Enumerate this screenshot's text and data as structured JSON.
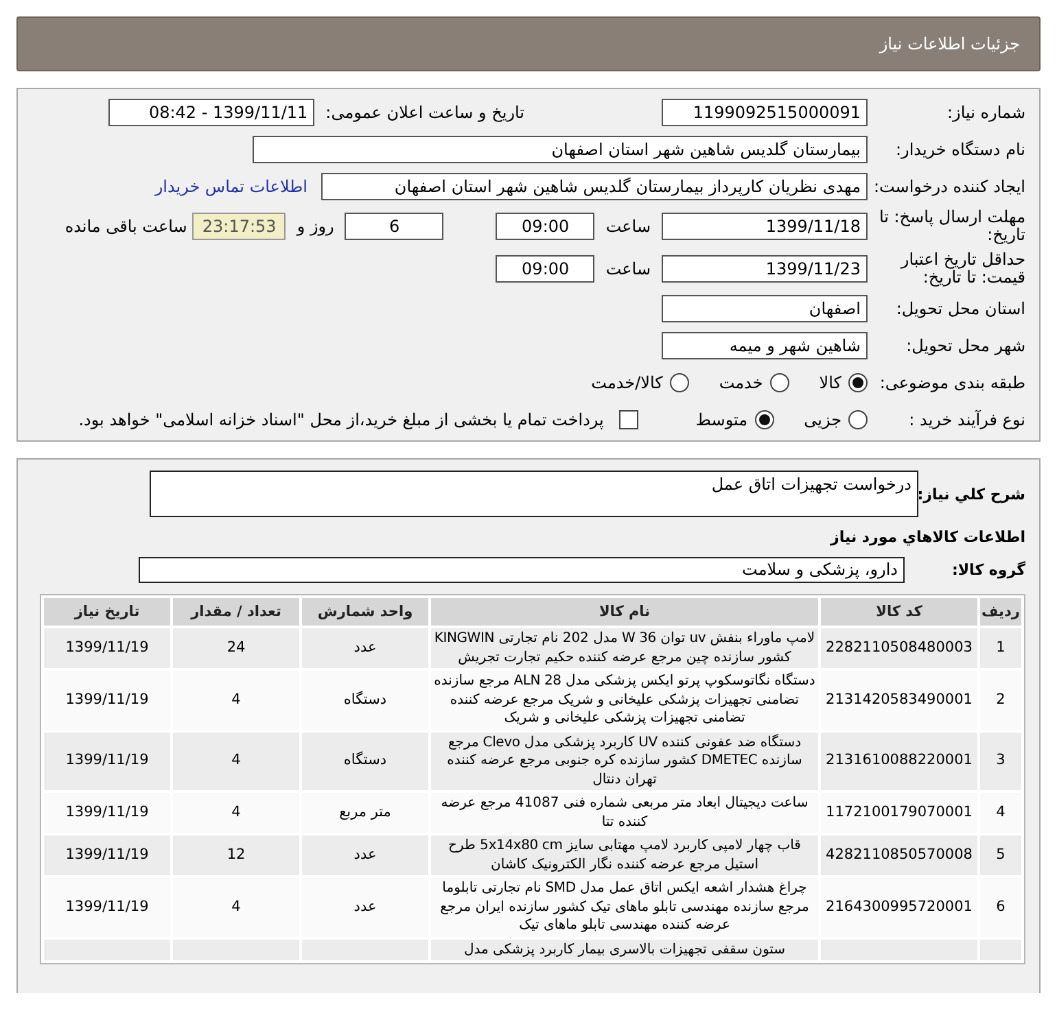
{
  "header": {
    "title": "جزئیات اطلاعات نیاز"
  },
  "need": {
    "need_number": {
      "label": "شماره نیاز:",
      "value": "1199092515000091"
    },
    "announce": {
      "label": "تاریخ و ساعت اعلان عمومی:",
      "value": "1399/11/11 - 08:42"
    },
    "buyer": {
      "label": "نام دستگاه خریدار:",
      "value": "بیمارستان گلدیس شاهین شهر استان اصفهان"
    },
    "creator": {
      "label": "ایجاد کننده درخواست:",
      "value": "مهدی نظریان کارپرداز بیمارستان گلدیس شاهین شهر استان اصفهان",
      "link": "اطلاعات تماس خریدار"
    },
    "deadline": {
      "label": "مهلت ارسال پاسخ: تا تاریخ:",
      "date": "1399/11/18",
      "time_label": "ساعت",
      "time": "09:00",
      "days": "6",
      "days_label": "روز و",
      "remaining": "23:17:53",
      "remaining_label": "ساعت باقی مانده"
    },
    "validity": {
      "label": "حداقل تاریخ اعتبار قیمت: تا تاریخ:",
      "date": "1399/11/23",
      "time_label": "ساعت",
      "time": "09:00"
    },
    "province": {
      "label": "استان محل تحویل:",
      "value": "اصفهان"
    },
    "city": {
      "label": "شهر محل تحویل:",
      "value": "شاهین شهر و میمه"
    },
    "category": {
      "label": "طبقه بندی موضوعی:",
      "options": [
        {
          "label": "کالا",
          "selected": true
        },
        {
          "label": "خدمت",
          "selected": false
        },
        {
          "label": "کالا/خدمت",
          "selected": false
        }
      ]
    },
    "process": {
      "label": "نوع فرآیند خرید :",
      "options": [
        {
          "label": "جزیی",
          "selected": false
        },
        {
          "label": "متوسط",
          "selected": true
        }
      ],
      "treasury": {
        "label": "پرداخت تمام یا بخشی از مبلغ خرید،از محل \"اسناد خزانه اسلامی\" خواهد بود.",
        "checked": false
      }
    }
  },
  "items": {
    "description": {
      "label": "شرح کلي نياز:",
      "value": "درخواست تجهيزات اتاق عمل"
    },
    "heading": "اطلاعات کالاهاي مورد نياز",
    "group": {
      "label": "گروه کالا:",
      "value": "دارو، پزشکی و سلامت"
    },
    "table": {
      "columns": [
        "ردیف",
        "کد کالا",
        "نام کالا",
        "واحد شمارش",
        "تعداد / مقدار",
        "تاریخ نیاز"
      ],
      "rows": [
        [
          "1",
          "2282110508480003",
          "لامپ ماوراء بنفش uv توان W 36 مدل 202 نام تجارتی KINGWIN کشور سازنده چین مرجع عرضه کننده حکیم تجارت تجریش",
          "عدد",
          "24",
          "1399/11/19"
        ],
        [
          "2",
          "2131420583490001",
          "دستگاه نگاتوسکوپ پرتو ایکس پزشکی مدل ALN 28 مرجع سازنده تضامنی تجهیزات پزشکی علیخانی و شریک مرجع عرضه کننده تضامنی تجهیزات پزشکی علیخانی و شریک",
          "دستگاه",
          "4",
          "1399/11/19"
        ],
        [
          "3",
          "2131610088220001",
          "دستگاه ضد عفونی کننده UV کاربرد پزشکی مدل Clevo مرجع سازنده DMETEC کشور سازنده کره جنوبی مرجع عرضه کننده تهران دنتال",
          "دستگاه",
          "4",
          "1399/11/19"
        ],
        [
          "4",
          "1172100179070001",
          "ساعت دیجیتال ابعاد متر مربعی شماره فنی 41087 مرجع عرضه کننده تتا",
          "متر مربع",
          "4",
          "1399/11/19"
        ],
        [
          "5",
          "4282110850570008",
          "قاب چهار لامپی کاربرد لامپ مهتابی سایز 5x14x80 cm طرح استیل مرجع عرضه کننده نگار الکترونیک کاشان",
          "عدد",
          "12",
          "1399/11/19"
        ],
        [
          "6",
          "2164300995720001",
          "چراغ هشدار اشعه ایکس اتاق عمل مدل SMD نام تجارتی تابلوما مرجع سازنده مهندسی تابلو ماهای تیک کشور سازنده ایران مرجع عرضه کننده مهندسی تابلو ماهای تیک",
          "عدد",
          "4",
          "1399/11/19"
        ],
        [
          "",
          "",
          "ستون سقفی تجهیزات بالاسری بیمار کاربرد پزشکی مدل",
          "",
          "",
          ""
        ]
      ]
    }
  }
}
